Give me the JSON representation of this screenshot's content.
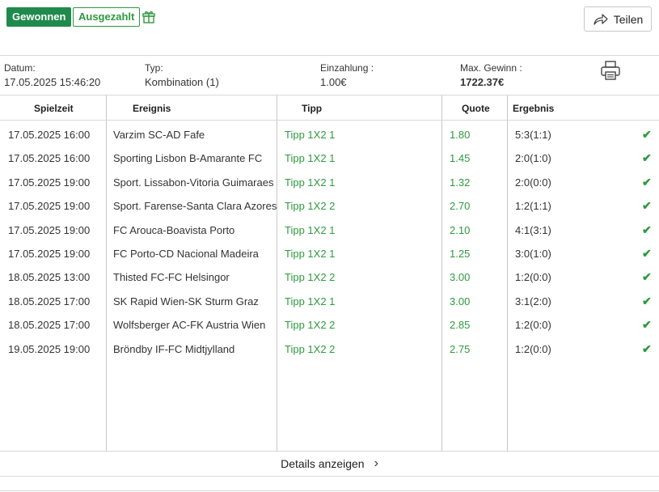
{
  "header": {
    "status_won": "Gewonnen",
    "status_paid": "Ausgezahlt",
    "gift_icon": "gift-icon",
    "share_label": "Teilen",
    "share_icon": "share-arrow-icon"
  },
  "info": {
    "date_label": "Datum:",
    "date_value": "17.05.2025 15:46:20",
    "type_label": "Typ:",
    "type_value": "Kombination (1)",
    "stake_label": "Einzahlung :",
    "stake_value": "1.00€",
    "maxwin_label": "Max. Gewinn :",
    "maxwin_value": "1722.37€",
    "print_icon": "printer-icon"
  },
  "table": {
    "headers": {
      "time": "Spielzeit",
      "event": "Ereignis",
      "tipp": "Tipp",
      "quote": "Quote",
      "result": "Ergebnis"
    },
    "rows": [
      {
        "time": "17.05.2025 16:00",
        "event": "Varzim SC-AD Fafe",
        "tipp": "Tipp 1X2 1",
        "quote": "1.80",
        "result": "5:3(1:1)",
        "check": "✔"
      },
      {
        "time": "17.05.2025 16:00",
        "event": "Sporting Lisbon B-Amarante FC",
        "tipp": "Tipp 1X2 1",
        "quote": "1.45",
        "result": "2:0(1:0)",
        "check": "✔"
      },
      {
        "time": "17.05.2025 19:00",
        "event": "Sport. Lissabon-Vitoria Guimaraes",
        "tipp": "Tipp 1X2 1",
        "quote": "1.32",
        "result": "2:0(0:0)",
        "check": "✔"
      },
      {
        "time": "17.05.2025 19:00",
        "event": "Sport. Farense-Santa Clara Azores",
        "tipp": "Tipp 1X2 2",
        "quote": "2.70",
        "result": "1:2(1:1)",
        "check": "✔"
      },
      {
        "time": "17.05.2025 19:00",
        "event": "FC Arouca-Boavista Porto",
        "tipp": "Tipp 1X2 1",
        "quote": "2.10",
        "result": "4:1(3:1)",
        "check": "✔"
      },
      {
        "time": "17.05.2025 19:00",
        "event": "FC Porto-CD Nacional Madeira",
        "tipp": "Tipp 1X2 1",
        "quote": "1.25",
        "result": "3:0(1:0)",
        "check": "✔"
      },
      {
        "time": "18.05.2025 13:00",
        "event": "Thisted FC-FC Helsingor",
        "tipp": "Tipp 1X2 2",
        "quote": "3.00",
        "result": "1:2(0:0)",
        "check": "✔"
      },
      {
        "time": "18.05.2025 17:00",
        "event": "SK Rapid Wien-SK Sturm Graz",
        "tipp": "Tipp 1X2 1",
        "quote": "3.00",
        "result": "3:1(2:0)",
        "check": "✔"
      },
      {
        "time": "18.05.2025 17:00",
        "event": "Wolfsberger AC-FK Austria Wien",
        "tipp": "Tipp 1X2 2",
        "quote": "2.85",
        "result": "1:2(0:0)",
        "check": "✔"
      },
      {
        "time": "19.05.2025 19:00",
        "event": "Bröndby IF-FC Midtjylland",
        "tipp": "Tipp 1X2 2",
        "quote": "2.75",
        "result": "1:2(0:0)",
        "check": "✔"
      }
    ]
  },
  "footer": {
    "details_label": "Details anzeigen",
    "chevron": "›",
    "chevron_icon": "chevron-right-icon"
  },
  "colors": {
    "accent_green": "#1f8a4c",
    "text_green": "#2e9a3e",
    "border": "#d8d8d8"
  }
}
